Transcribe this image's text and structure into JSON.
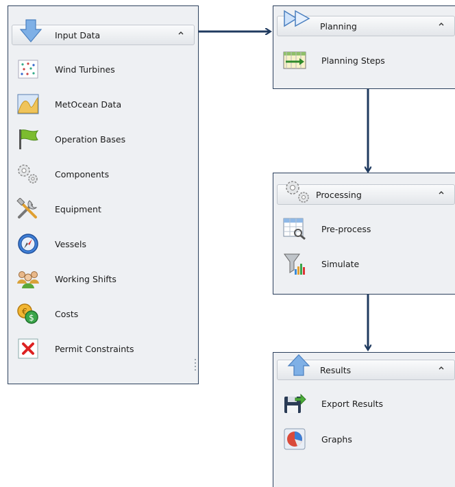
{
  "panels": {
    "input_data": {
      "title": "Input Data",
      "items": [
        {
          "label": "Wind Turbines",
          "icon": "wind-turbines-icon"
        },
        {
          "label": "MetOcean Data",
          "icon": "metocean-icon"
        },
        {
          "label": "Operation Bases",
          "icon": "flag-icon"
        },
        {
          "label": "Components",
          "icon": "gears-icon"
        },
        {
          "label": "Equipment",
          "icon": "tools-icon"
        },
        {
          "label": "Vessels",
          "icon": "compass-icon"
        },
        {
          "label": "Working Shifts",
          "icon": "people-icon"
        },
        {
          "label": "Costs",
          "icon": "coins-icon"
        },
        {
          "label": "Permit Constraints",
          "icon": "permit-icon"
        }
      ]
    },
    "planning": {
      "title": "Planning",
      "items": [
        {
          "label": "Planning Steps",
          "icon": "planning-steps-icon"
        }
      ]
    },
    "processing": {
      "title": "Processing",
      "items": [
        {
          "label": "Pre-process",
          "icon": "preprocess-icon"
        },
        {
          "label": "Simulate",
          "icon": "simulate-icon"
        }
      ]
    },
    "results": {
      "title": "Results",
      "items": [
        {
          "label": "Export Results",
          "icon": "export-icon"
        },
        {
          "label": "Graphs",
          "icon": "pie-chart-icon"
        }
      ]
    }
  },
  "colors": {
    "border": "#2b3f5c",
    "panel_bg": "#eef0f3",
    "arrow": "#1f3a5f"
  }
}
